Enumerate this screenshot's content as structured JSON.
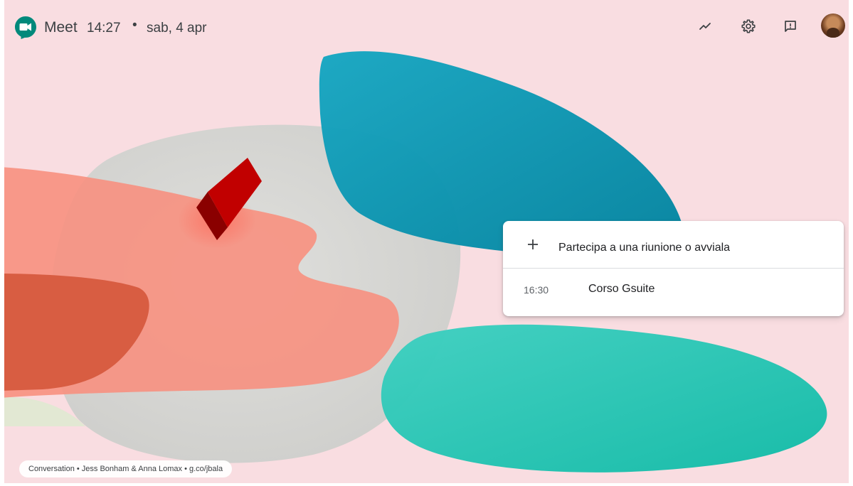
{
  "header": {
    "app_title": "Meet",
    "time": "14:27",
    "separator": "•",
    "date": "sab, 4 apr"
  },
  "toolbar_icons": [
    "activity-icon",
    "settings-icon",
    "feedback-icon",
    "avatar"
  ],
  "card": {
    "join_label": "Partecipa a una riunione o avviala",
    "meetings": [
      {
        "time": "16:30",
        "name": "Corso Gsuite"
      }
    ]
  },
  "credit": {
    "text": "Conversation • Jess Bonham & Anna Lomax • g.co/jbala"
  },
  "colors": {
    "background": "#f9dde1",
    "teal_blob": "#0e9ab4",
    "mint_blob": "#2ec7b5",
    "coral_blob": "#f7907f",
    "red_shape": "#c40000",
    "grey_blob": "#dcdcda"
  }
}
